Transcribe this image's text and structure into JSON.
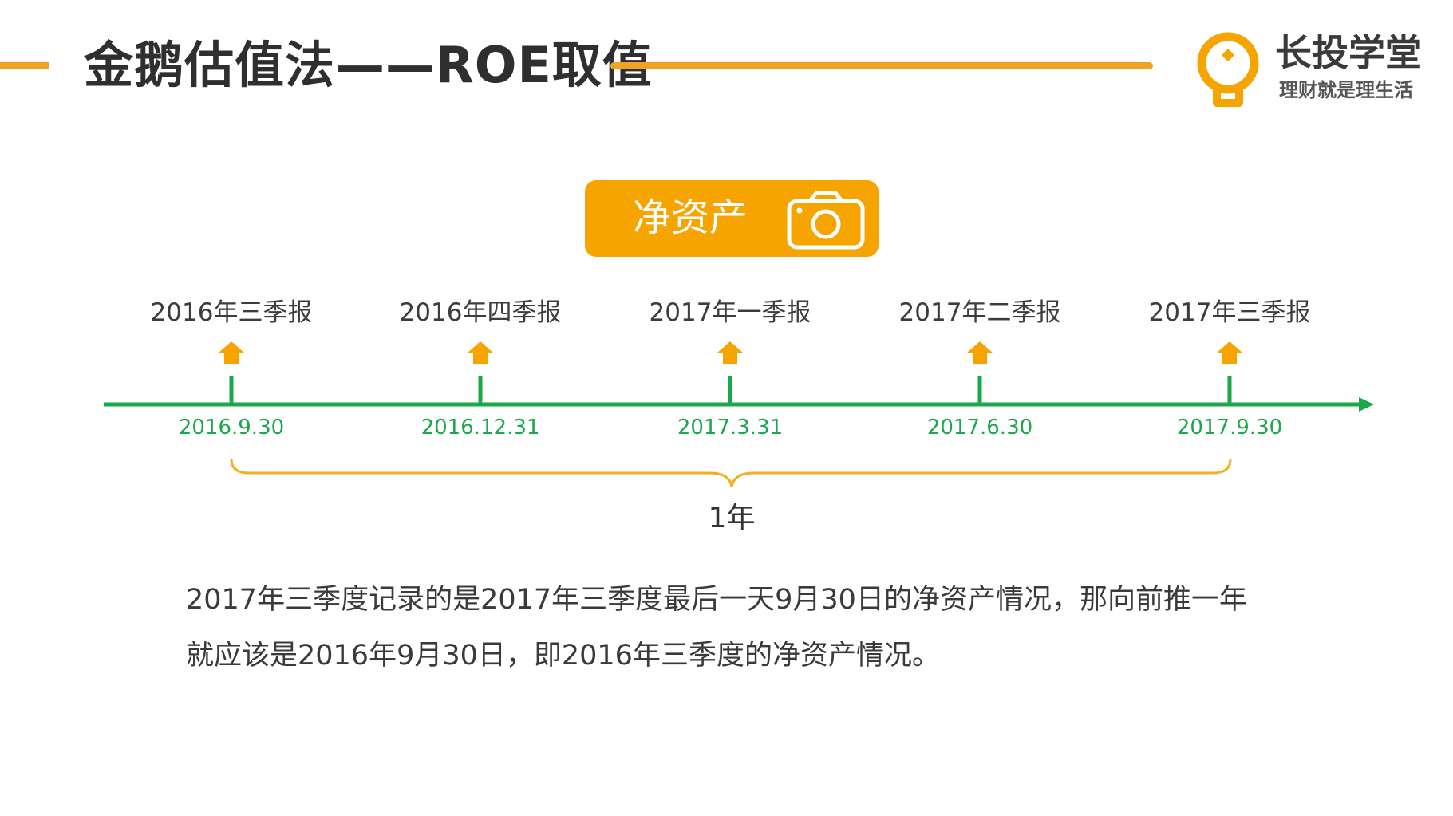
{
  "header": {
    "title": "金鹅估值法——ROE取值",
    "accent_color": "#f0a224"
  },
  "logo": {
    "icon": "lightbulb-icon",
    "name": "长投学堂",
    "slogan": "理财就是理生活",
    "color": "#f5a400"
  },
  "badge": {
    "label": "净资产",
    "icon": "camera-icon",
    "color": "#f5a400"
  },
  "timeline": {
    "line_color": "#1aa84a",
    "arrow_color": "#f5a400",
    "brace_color": "#f0b020",
    "events": [
      {
        "period": "2016年三季报",
        "date": "2016.9.30"
      },
      {
        "period": "2016年四季报",
        "date": "2016.12.31"
      },
      {
        "period": "2017年一季报",
        "date": "2017.3.31"
      },
      {
        "period": "2017年二季报",
        "date": "2017.6.30"
      },
      {
        "period": "2017年三季报",
        "date": "2017.9.30"
      }
    ],
    "span_label": "1年"
  },
  "description": {
    "line1": "2017年三季度记录的是2017年三季度最后一天9月30日的净资产情况，那向前推一年",
    "line2": "就应该是2016年9月30日，即2016年三季度的净资产情况。"
  }
}
